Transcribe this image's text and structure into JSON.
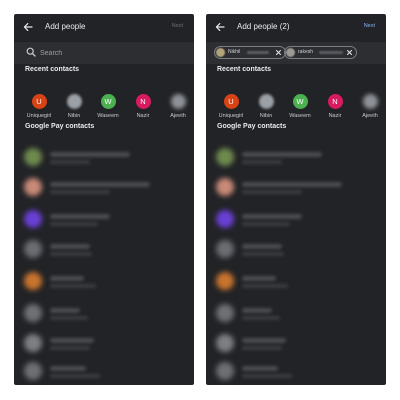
{
  "screens": [
    {
      "title": "Add people",
      "next_label": "Next",
      "search": {
        "placeholder": "Search"
      },
      "recent_title": "Recent contacts",
      "gpay_title": "Google Pay contacts",
      "recent": [
        {
          "initial": "U",
          "name": "Uniquegirl",
          "color": "#d84315"
        },
        {
          "initial": "",
          "name": "Nibin",
          "color": "#9aa0a6"
        },
        {
          "initial": "W",
          "name": "Waseem",
          "color": "#4caf50"
        },
        {
          "initial": "N",
          "name": "Nazir",
          "color": "#d81b60"
        },
        {
          "initial": "",
          "name": "Ajeeth",
          "color": "#8e9298"
        }
      ]
    },
    {
      "title": "Add people (2)",
      "next_label": "Next",
      "selected": [
        {
          "name": "Nikhil"
        },
        {
          "name": "rakesh"
        }
      ],
      "recent_title": "Recent contacts",
      "gpay_title": "Google Pay contacts",
      "recent": [
        {
          "initial": "U",
          "name": "Uniquegirl",
          "color": "#d84315"
        },
        {
          "initial": "",
          "name": "Nibin",
          "color": "#9aa0a6"
        },
        {
          "initial": "W",
          "name": "Waseem",
          "color": "#4caf50"
        },
        {
          "initial": "N",
          "name": "Nazir",
          "color": "#d81b60"
        },
        {
          "initial": "",
          "name": "Ajeeth",
          "color": "#8e9298"
        }
      ]
    }
  ],
  "icons": {
    "back": "arrow-left-icon",
    "search": "magnifier-icon",
    "remove": "close-icon"
  },
  "colors": {
    "screen_bg": "#222326",
    "search_bg": "#2d2e31",
    "text": "#e8eaed",
    "next_disabled": "#6c6f75",
    "next_enabled": "#8ab4f8"
  },
  "gpay_avatar_colors": [
    "#6f8a4e",
    "#c98a78",
    "#6a3fd6",
    "#6a6d72",
    "#c8742e",
    "#6f7176",
    "#7d7f84",
    "#6d6f74"
  ]
}
